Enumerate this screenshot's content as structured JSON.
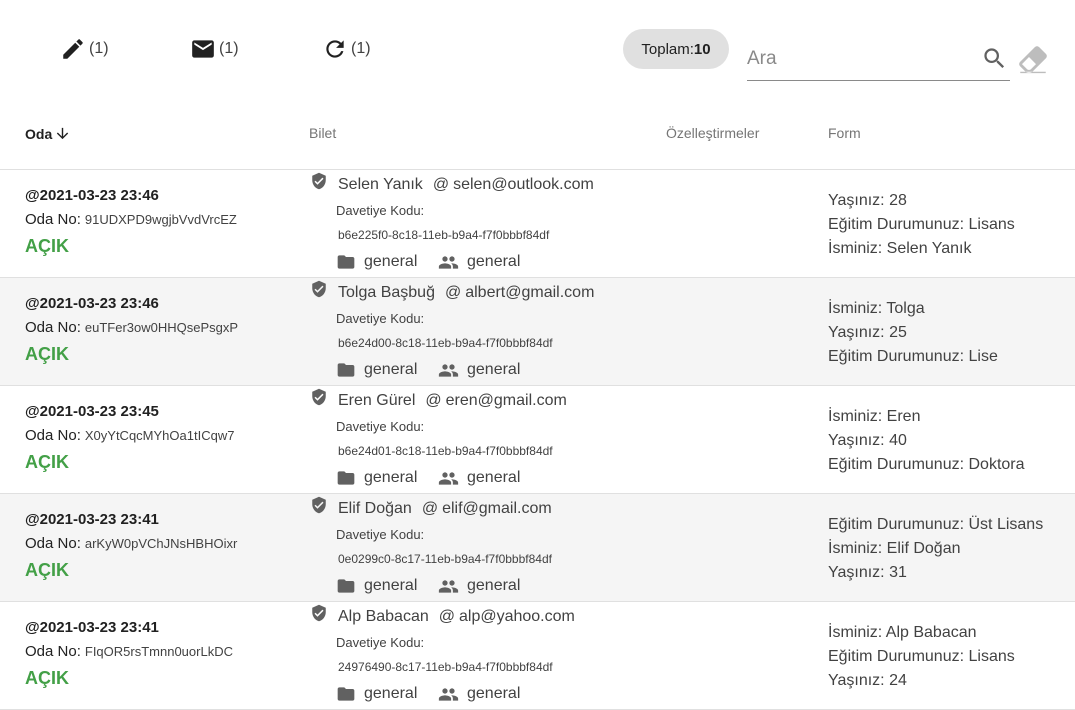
{
  "toolbar": {
    "edit_count": "(1)",
    "mail_count": "(1)",
    "refresh_count": "(1)",
    "total_label": "Toplam:",
    "total_value": "10",
    "search_placeholder": "Ara",
    "search_value": ""
  },
  "icons": [
    "pencil-icon",
    "mail-icon",
    "refresh-icon",
    "search-icon",
    "eraser-icon",
    "arrow-down-icon",
    "shield-icon",
    "folder-icon",
    "people-icon"
  ],
  "colors": {
    "status_open": "#43a047",
    "row_alt_bg": "#f5f5f5",
    "chip_bg": "#e0e0e0"
  },
  "columns": {
    "room": "Oda",
    "ticket": "Bilet",
    "custom": "Özelleştirmeler",
    "form": "Form"
  },
  "rows": [
    {
      "date": "@2021-03-23 23:46",
      "room_label": "Oda No:",
      "room_code": "91UDXPD9wgjbVvdVrcEZ",
      "status": "AÇIK",
      "name": "Selen Yanık",
      "at": "@",
      "email": "selen@outlook.com",
      "invite_label": "Davetiye Kodu:",
      "invite_code": "b6e225f0-8c18-11eb-b9a4-f7f0bbbf84df",
      "folder": "general",
      "group": "general",
      "form": [
        "Yaşınız: 28",
        "Eğitim Durumunuz: Lisans",
        "İsminiz: Selen Yanık"
      ]
    },
    {
      "date": "@2021-03-23 23:46",
      "room_label": "Oda No:",
      "room_code": "euTFer3ow0HHQsePsgxP",
      "status": "AÇIK",
      "name": "Tolga Başbuğ",
      "at": "@",
      "email": "albert@gmail.com",
      "invite_label": "Davetiye Kodu:",
      "invite_code": "b6e24d00-8c18-11eb-b9a4-f7f0bbbf84df",
      "folder": "general",
      "group": "general",
      "form": [
        "İsminiz: Tolga",
        "Yaşınız: 25",
        "Eğitim Durumunuz: Lise"
      ]
    },
    {
      "date": "@2021-03-23 23:45",
      "room_label": "Oda No:",
      "room_code": "X0yYtCqcMYhOa1tICqw7",
      "status": "AÇIK",
      "name": "Eren Gürel",
      "at": "@",
      "email": "eren@gmail.com",
      "invite_label": "Davetiye Kodu:",
      "invite_code": "b6e24d01-8c18-11eb-b9a4-f7f0bbbf84df",
      "folder": "general",
      "group": "general",
      "form": [
        "İsminiz: Eren",
        "Yaşınız: 40",
        "Eğitim Durumunuz: Doktora"
      ]
    },
    {
      "date": "@2021-03-23 23:41",
      "room_label": "Oda No:",
      "room_code": "arKyW0pVChJNsHBHOixr",
      "status": "AÇIK",
      "name": "Elif Doğan",
      "at": "@",
      "email": "elif@gmail.com",
      "invite_label": "Davetiye Kodu:",
      "invite_code": "0e0299c0-8c17-11eb-b9a4-f7f0bbbf84df",
      "folder": "general",
      "group": "general",
      "form": [
        "Eğitim Durumunuz: Üst Lisans",
        "İsminiz: Elif Doğan",
        "Yaşınız: 31"
      ]
    },
    {
      "date": "@2021-03-23 23:41",
      "room_label": "Oda No:",
      "room_code": "FIqOR5rsTmnn0uorLkDC",
      "status": "AÇIK",
      "name": "Alp Babacan",
      "at": "@",
      "email": "alp@yahoo.com",
      "invite_label": "Davetiye Kodu:",
      "invite_code": "24976490-8c17-11eb-b9a4-f7f0bbbf84df",
      "folder": "general",
      "group": "general",
      "form": [
        "İsminiz: Alp Babacan",
        "Eğitim Durumunuz: Lisans",
        "Yaşınız: 24"
      ]
    }
  ]
}
